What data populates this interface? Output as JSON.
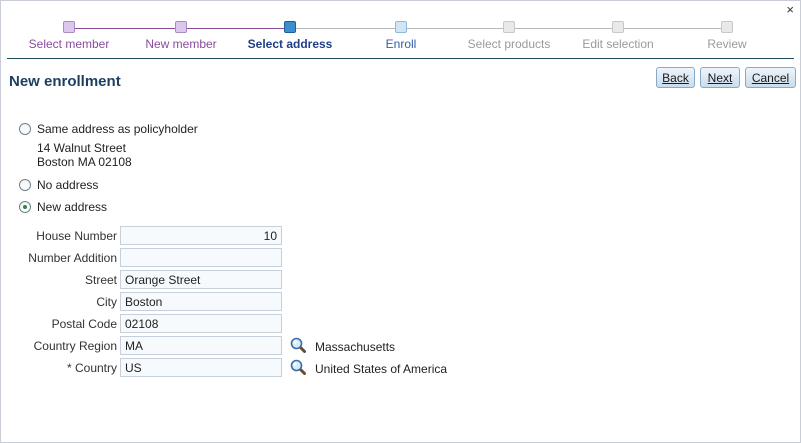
{
  "close_glyph": "×",
  "wizard": {
    "steps": [
      {
        "label": "Select member",
        "state": "done"
      },
      {
        "label": "New member",
        "state": "done"
      },
      {
        "label": "Select address",
        "state": "current"
      },
      {
        "label": "Enroll",
        "state": "next"
      },
      {
        "label": "Select products",
        "state": "todo"
      },
      {
        "label": "Edit selection",
        "state": "todo"
      },
      {
        "label": "Review",
        "state": "todo"
      }
    ],
    "colors": {
      "done": "#a98bc6",
      "current": "#3c8fcf",
      "todo": "#c8c8c8"
    }
  },
  "page": {
    "title": "New enrollment"
  },
  "actions": {
    "back": "Back",
    "next": "Next",
    "cancel": "Cancel"
  },
  "address_choice": {
    "same": {
      "label": "Same address as policyholder",
      "line1": "14 Walnut Street",
      "line2": "Boston MA 02108"
    },
    "none": {
      "label": "No address"
    },
    "new": {
      "label": "New address"
    },
    "selected": "new"
  },
  "form": {
    "house_number": {
      "label": "House Number",
      "value": "10"
    },
    "number_addition": {
      "label": "Number Addition",
      "value": ""
    },
    "street": {
      "label": "Street",
      "value": "Orange Street"
    },
    "city": {
      "label": "City",
      "value": "Boston"
    },
    "postal_code": {
      "label": "Postal Code",
      "value": "02108"
    },
    "country_region": {
      "label": "Country Region",
      "value": "MA",
      "resolved": "Massachusetts",
      "icon": "magnifier-icon"
    },
    "country": {
      "label": "* Country",
      "value": "US",
      "resolved": "United States of America",
      "icon": "magnifier-icon"
    }
  }
}
